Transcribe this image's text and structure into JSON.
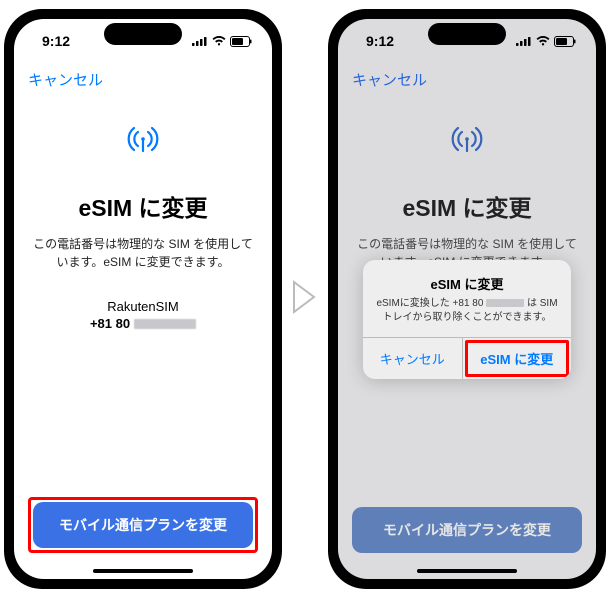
{
  "statusbar": {
    "time": "9:12"
  },
  "nav": {
    "cancel": "キャンセル"
  },
  "page": {
    "title": "eSIM に変更",
    "desc": "この電話番号は物理的な SIM を使用しています。eSIM に変更できます。",
    "carrier": "RakutenSIM",
    "phone": "+81 80"
  },
  "footer": {
    "primary": "モバイル通信プランを変更"
  },
  "alert": {
    "title": "eSIM に変更",
    "text_prefix": "eSIMに変換した +81 80 ",
    "text_suffix": " は SIMトレイから取り除くことができます。",
    "cancel": "キャンセル",
    "confirm": "eSIM に変更"
  }
}
